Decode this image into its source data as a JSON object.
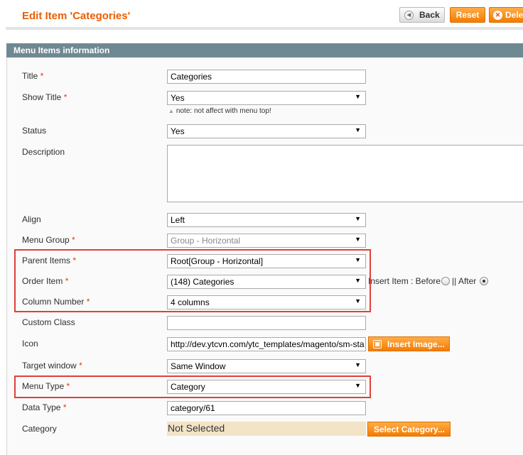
{
  "header": {
    "title": "Edit Item 'Categories'",
    "back_label": "Back",
    "reset_label": "Reset",
    "delete_label": "Dele"
  },
  "section": {
    "title": "Menu Items information"
  },
  "form": {
    "title": {
      "label": "Title",
      "value": "Categories"
    },
    "show_title": {
      "label": "Show Title",
      "value": "Yes",
      "note": "note: not affect with menu top!"
    },
    "status": {
      "label": "Status",
      "value": "Yes"
    },
    "description": {
      "label": "Description",
      "value": ""
    },
    "align": {
      "label": "Align",
      "value": "Left"
    },
    "menu_group": {
      "label": "Menu Group",
      "value": "Group - Horizontal"
    },
    "parent_items": {
      "label": "Parent Items",
      "value": "Root[Group - Horizontal]"
    },
    "order_item": {
      "label": "Order Item",
      "value": "(148) Categories",
      "insert_label": "Insert Item : Before",
      "separator": "|| After",
      "insert_selected": "After"
    },
    "column_number": {
      "label": "Column Number",
      "value": "4 columns"
    },
    "custom_class": {
      "label": "Custom Class",
      "value": ""
    },
    "icon": {
      "label": "Icon",
      "value": "http://dev.ytcvn.com/ytc_templates/magento/sm-sta",
      "button_label": "Insert Image..."
    },
    "target_window": {
      "label": "Target window",
      "value": "Same Window"
    },
    "menu_type": {
      "label": "Menu Type",
      "value": "Category"
    },
    "data_type": {
      "label": "Data Type",
      "value": "category/61"
    },
    "category": {
      "label": "Category",
      "value": "Not Selected",
      "button_label": "Select Category..."
    }
  },
  "colors": {
    "accent": "#eb5e00",
    "section_header": "#6f8992",
    "highlight_box": "#e0403a",
    "required": "#eb340a"
  }
}
